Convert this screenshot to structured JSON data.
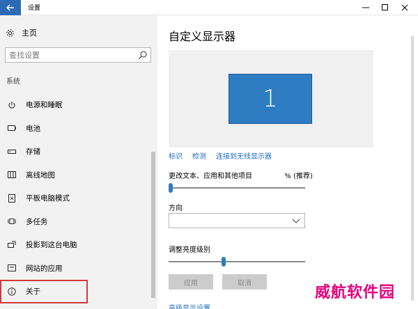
{
  "window": {
    "title": "设置"
  },
  "sidebar": {
    "home_label": "主页",
    "search_placeholder": "查找设置",
    "section_label": "系统",
    "items": [
      {
        "label": "电源和睡眠",
        "icon": "power-icon"
      },
      {
        "label": "电池",
        "icon": "battery-icon"
      },
      {
        "label": "存储",
        "icon": "storage-icon"
      },
      {
        "label": "离线地图",
        "icon": "map-icon"
      },
      {
        "label": "平板电脑模式",
        "icon": "tablet-icon"
      },
      {
        "label": "多任务",
        "icon": "multitask-icon"
      },
      {
        "label": "投影到这台电脑",
        "icon": "projection-icon"
      },
      {
        "label": "网站的应用",
        "icon": "web-apps-icon"
      },
      {
        "label": "关于",
        "icon": "info-icon",
        "highlighted": true
      }
    ]
  },
  "main": {
    "title": "自定义显示器",
    "monitor_number": "1",
    "links": [
      "标识",
      "检测",
      "连接到无线显示器"
    ],
    "scale_label": "更改文本、应用和其他项目",
    "scale_suffix": "% (推荐)",
    "scale_level": 0.0,
    "orientation_label": "方向",
    "orientation_value": "",
    "brightness_label": "调整亮度级别",
    "brightness_level": 0.4,
    "apply_label": "应用",
    "cancel_label": "取消",
    "advanced_link": "高级显示设置"
  },
  "watermark": "威航软件园",
  "colors": {
    "accent": "#2e7dc3",
    "highlight_border": "#d23a3a",
    "link": "#1f6ebf",
    "watermark": "#e5007e"
  }
}
